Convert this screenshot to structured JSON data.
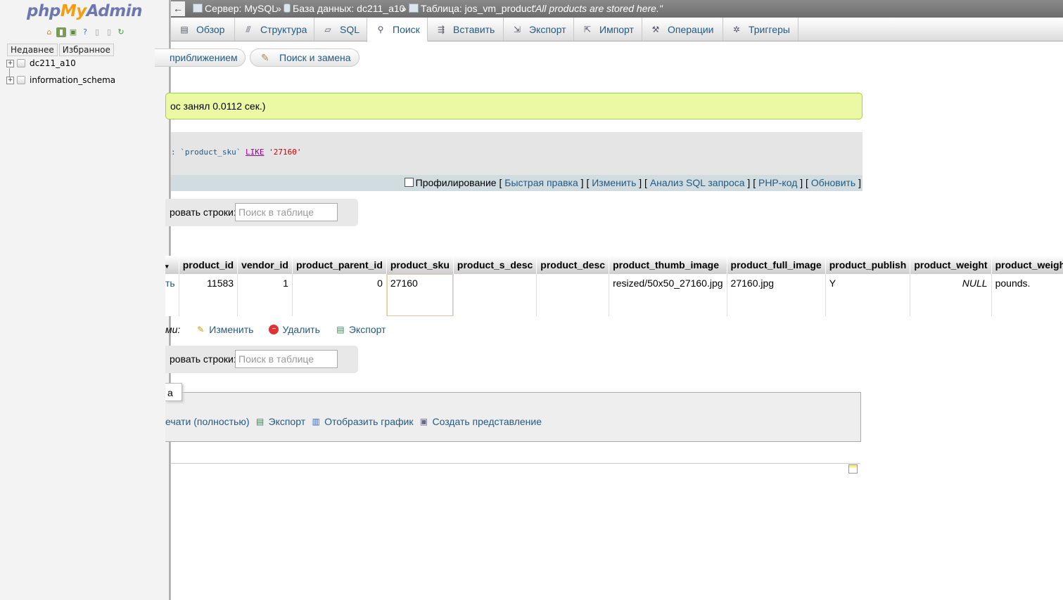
{
  "nav": {
    "logo": {
      "php": "php",
      "my": "My",
      "admin": "Admin"
    },
    "tabs": [
      "Недавнее",
      "Избранное"
    ],
    "databases": [
      "dc211_a10",
      "information_schema"
    ]
  },
  "breadcrumb": {
    "back": "←",
    "server": "Сервер: MySQL",
    "database": "База данных: dc211_a10",
    "table": "Таблица: jos_vm_product",
    "comment": "\"All products are stored here.\"",
    "sep": "»"
  },
  "tabs": [
    {
      "label": "Обзор",
      "icon": "browse-icon"
    },
    {
      "label": "Структура",
      "icon": "structure-icon"
    },
    {
      "label": "SQL",
      "icon": "sql-icon"
    },
    {
      "label": "Поиск",
      "icon": "search-icon",
      "active": true
    },
    {
      "label": "Вставить",
      "icon": "insert-icon"
    },
    {
      "label": "Экспорт",
      "icon": "export-icon"
    },
    {
      "label": "Импорт",
      "icon": "import-icon"
    },
    {
      "label": "Операции",
      "icon": "wrench-icon"
    },
    {
      "label": "Триггеры",
      "icon": "triggers-icon"
    }
  ],
  "subtabs": {
    "zoom": "приближением",
    "replace": "Поиск и замена"
  },
  "message": "ос занял 0.0112 сек.)",
  "sql": {
    "part1": ": `product_sku` ",
    "keyword": "LIKE",
    "value": " '27160'"
  },
  "sql_links": {
    "profiling": "Профилирование",
    "inline_edit": "Быстрая правка",
    "edit": "Изменить",
    "explain": "Анализ SQL запроса",
    "php_code": "PHP-код",
    "refresh": "Обновить"
  },
  "filter": {
    "label": "ровать строки:",
    "placeholder": "Поиск в таблице"
  },
  "table": {
    "headers": [
      "product_id",
      "vendor_id",
      "product_parent_id",
      "product_sku",
      "product_s_desc",
      "product_desc",
      "product_thumb_image",
      "product_full_image",
      "product_publish",
      "product_weight",
      "product_weight"
    ],
    "row": {
      "action": "ть",
      "product_id": "11583",
      "vendor_id": "1",
      "product_parent_id": "0",
      "product_sku": "27160",
      "product_s_desc": "",
      "product_desc": "",
      "product_thumb_image": "resized/50x50_27160.jpg",
      "product_full_image": "27160.jpg",
      "product_publish": "Y",
      "product_weight": "NULL",
      "product_weight_uom": "pounds."
    }
  },
  "bulk": {
    "label": "ми:",
    "edit": "Изменить",
    "delete": "Удалить",
    "export": "Экспорт"
  },
  "operations": {
    "legend": "а",
    "print": "ечати (полностью)",
    "export": "Экспорт",
    "chart": "Отобразить график",
    "view": "Создать представление"
  }
}
